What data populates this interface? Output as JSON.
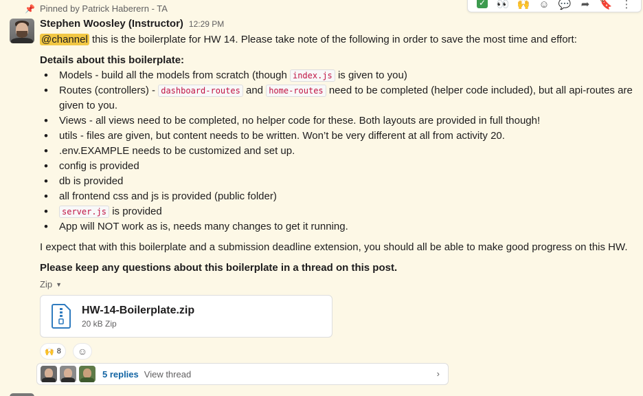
{
  "pinned": {
    "text": "Pinned by Patrick Haberern - TA"
  },
  "message": {
    "author": "Stephen Woosley (Instructor)",
    "time": "12:29 PM",
    "mention": "@channel",
    "intro": " this is the boilerplate for HW 14. Please take note of the following in order to save the most time and effort:",
    "details_heading": "Details about this boilerplate:",
    "bullets": {
      "b1_pre": "Models - build all the models from scratch (though ",
      "b1_code": "index.js",
      "b1_post": " is given to you)",
      "b2_pre": "Routes (controllers) - ",
      "b2_code1": "dashboard-routes",
      "b2_mid": " and ",
      "b2_code2": "home-routes",
      "b2_post": " need to be completed (helper code included), but all api-routes are given to you.",
      "b3": "Views - all views need to be completed, no helper code for these. Both layouts are provided in full though!",
      "b4": "utils - files are given, but content needs to be written. Won’t be very different at all from activity 20.",
      "b5": ".env.EXAMPLE needs to be customized and set up.",
      "b6": "config is provided",
      "b7": "db is provided",
      "b8": "all frontend css and js is provided (public folder)",
      "b9_code": "server.js",
      "b9_post": " is provided",
      "b10": "App will NOT work as is, needs many changes to get it running."
    },
    "closing": "I expect that with this boilerplate and a submission deadline extension, you should all be able to make good progress on this HW.",
    "closing_bold": "Please keep any questions about this boilerplate in a thread on this post."
  },
  "attachment": {
    "group_label": "Zip",
    "file_name": "HW-14-Boilerplate.zip",
    "file_meta": "20 kB Zip"
  },
  "reactions": {
    "emoji": "🙌",
    "count": "8"
  },
  "thread": {
    "replies": "5 replies",
    "view_label": "View thread"
  },
  "colors": {
    "background": "#fdf8e6",
    "link": "#1264a3",
    "mention_bg": "#f2c744",
    "code": "#c01343"
  }
}
